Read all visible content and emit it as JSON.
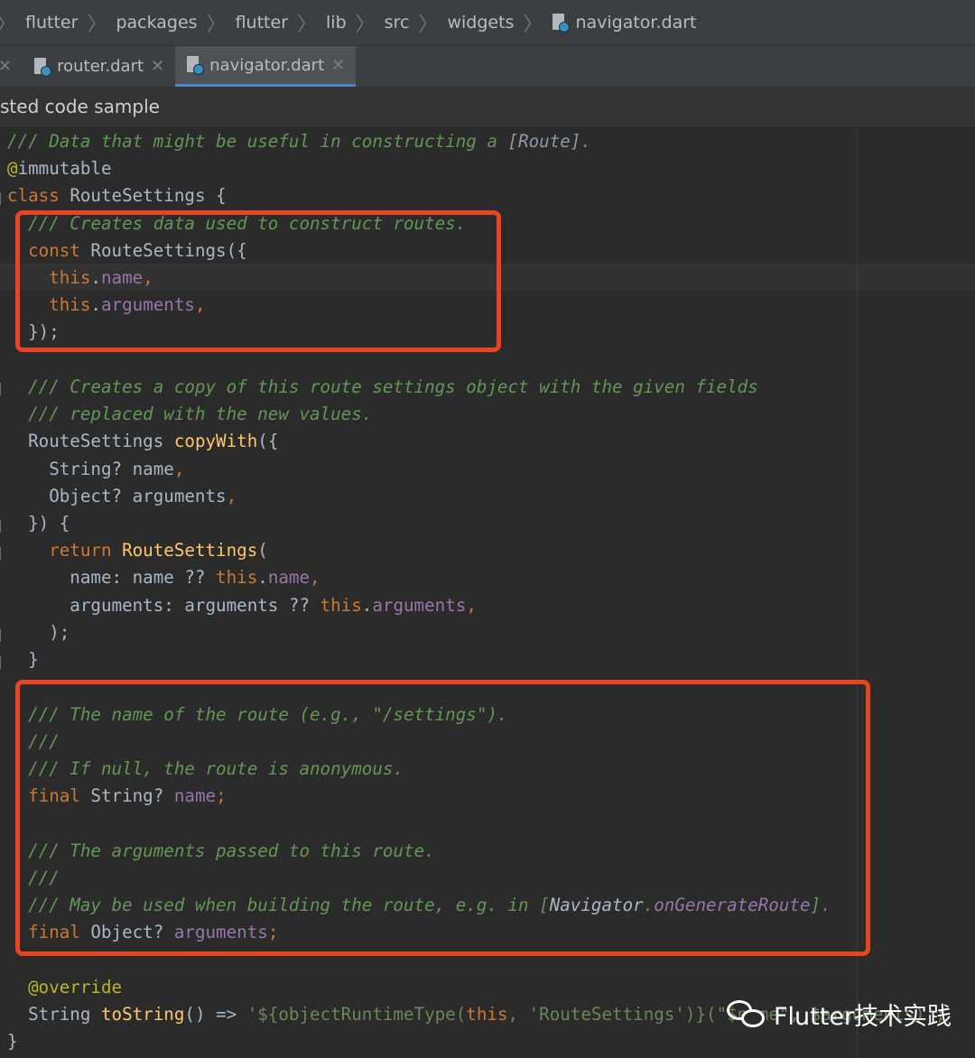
{
  "breadcrumb": {
    "items": [
      "flutter",
      "packages",
      "flutter",
      "lib",
      "src",
      "widgets",
      "navigator.dart"
    ]
  },
  "tabs": [
    {
      "label": "router.dart",
      "active": false
    },
    {
      "label": "navigator.dart",
      "active": true
    }
  ],
  "subheader": {
    "label": "sted code sample"
  },
  "code": {
    "l1": "/// Data that might be useful in constructing a ",
    "l1_ref": "[Route]",
    "l1_end": ".",
    "l2_at": "@",
    "l2_rest": "immutable",
    "l3_kw": "class",
    "l3_rest": " RouteSettings {",
    "l4": "  /// Creates data used to construct routes.",
    "l5_kw": "  const",
    "l5_rest": " RouteSettings({",
    "l6_this": "    this",
    "l6_dot": ".",
    "l6_fld": "name",
    "l6_comma": ",",
    "l7_this": "    this",
    "l7_dot": ".",
    "l7_fld": "arguments",
    "l7_comma": ",",
    "l8": "  });",
    "l10": "  /// Creates a copy of this route settings object with the given fields",
    "l11": "  /// replaced with the new values.",
    "l12_a": "  RouteSettings ",
    "l12_fn": "copyWith",
    "l12_b": "({",
    "l13_a": "    String? name",
    "l13_b": ",",
    "l14_a": "    Object? arguments",
    "l14_b": ",",
    "l15": "  }) {",
    "l16_kw": "    return",
    "l16_fn": " RouteSettings",
    "l16_b": "(",
    "l17_a": "      name: name ?? ",
    "l17_this": "this",
    "l17_dot": ".",
    "l17_fld": "name",
    "l17_c": ",",
    "l18_a": "      arguments: arguments ?? ",
    "l18_this": "this",
    "l18_dot": ".",
    "l18_fld": "arguments",
    "l18_c": ",",
    "l19": "    );",
    "l20": "  }",
    "l22": "  /// The name of the route (e.g., \"/settings\").",
    "l23": "  ///",
    "l24": "  /// If null, the route is anonymous.",
    "l25_kw": "  final",
    "l25_a": " String? ",
    "l25_fld": "name",
    "l25_c": ";",
    "l27": "  /// The arguments passed to this route.",
    "l28": "  ///",
    "l29_a": "  /// May be used when building the route, e.g. in [",
    "l29_id": "Navigator",
    "l29_dot": ".",
    "l29_fld": "onGenerateRoute",
    "l29_end": "].",
    "l30_kw": "  final",
    "l30_a": " Object? ",
    "l30_fld": "arguments",
    "l30_c": ";",
    "l32_at": "  @",
    "l32_rest": "override",
    "l33_a": "  String ",
    "l33_fn": "toString",
    "l33_b": "() => ",
    "l33_str": "'${objectRuntimeType(",
    "l33_this": "this",
    "l33_str2": ", 'RouteSettings')}(",
    "l33_tail": "\"$name\", $arguments)';",
    "l34": "}"
  },
  "watermark": {
    "text": "Flutter技术实践"
  },
  "colors": {
    "accent_box": "#e8441f",
    "tab_underline": "#4a88c7"
  }
}
